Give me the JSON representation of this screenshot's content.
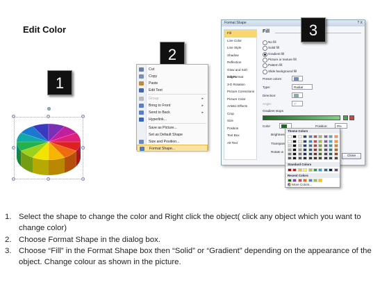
{
  "title": "Edit Color",
  "steps_badges": [
    "1",
    "2",
    "3"
  ],
  "context_menu": {
    "items": [
      {
        "label": "Cut",
        "icon": "scissors-icon",
        "icon_color": "#6a7f9c"
      },
      {
        "label": "Copy",
        "icon": "copy-icon",
        "icon_color": "#7d8fb0"
      },
      {
        "label": "Paste",
        "icon": "paste-icon",
        "icon_color": "#b88a45"
      },
      {
        "label": "Edit Text",
        "icon": "text-icon",
        "icon_color": "#4466aa"
      },
      {
        "label": "Group",
        "icon": "group-icon",
        "icon_color": "#bbbbbb",
        "disabled": true,
        "submenu": true
      },
      {
        "label": "Bring to Front",
        "icon": "bring-front-icon",
        "icon_color": "#5b7fc4",
        "submenu": true
      },
      {
        "label": "Send to Back",
        "icon": "send-back-icon",
        "icon_color": "#5b7fc4",
        "submenu": true
      },
      {
        "label": "Hyperlink...",
        "icon": "hyperlink-icon",
        "icon_color": "#3a66b8"
      },
      {
        "label": "Save as Picture...",
        "icon": "",
        "icon_color": ""
      },
      {
        "label": "Set as Default Shape",
        "icon": "",
        "icon_color": ""
      },
      {
        "label": "Size and Position...",
        "icon": "size-icon",
        "icon_color": "#6a8bc2"
      },
      {
        "label": "Format Shape...",
        "icon": "format-shape-icon",
        "icon_color": "#4a7cc9",
        "highlighted": true
      }
    ]
  },
  "format_dialog": {
    "title": "Format Shape",
    "close": "?  X",
    "sidebar": [
      "Fill",
      "Line Color",
      "Line Style",
      "Shadow",
      "Reflection",
      "Glow and Soft Edges",
      "3-D Format",
      "3-D Rotation",
      "Picture Corrections",
      "Picture Color",
      "Artistic Effects",
      "Crop",
      "Size",
      "Position",
      "Text Box",
      "Alt Text"
    ],
    "fill_heading": "Fill",
    "fill_options": [
      {
        "label": "No fill",
        "selected": false
      },
      {
        "label": "Solid fill",
        "selected": false
      },
      {
        "label": "Gradient fill",
        "selected": true
      },
      {
        "label": "Picture or texture fill",
        "selected": false
      },
      {
        "label": "Pattern fill",
        "selected": false
      },
      {
        "label": "Slide background fill",
        "selected": false
      }
    ],
    "preset_colors_label": "Preset colors:",
    "type_label": "Type:",
    "type_value": "Radial",
    "direction_label": "Direction:",
    "angle_label": "Angle:",
    "angle_value": "0°",
    "gradient_stops_label": "Gradient stops",
    "color_label": "Color",
    "position_label": "Position:",
    "position_value": "0%",
    "brightness_label": "Brightness:",
    "transparency_label": "Transparency:",
    "rotate_label": "Rotate w",
    "close_button": "Close"
  },
  "color_picker": {
    "theme_heading": "Theme Colors",
    "standard_heading": "Standard Colors",
    "recent_heading": "Recent Colors",
    "more_colors": "More Colors...",
    "theme_top": [
      "#ffffff",
      "#000000",
      "#eeece1",
      "#1f497d",
      "#4f81bd",
      "#c0504d",
      "#9bbb59",
      "#8064a2",
      "#4bacc6",
      "#f79646"
    ],
    "standard": [
      "#c00000",
      "#ff0000",
      "#ffc000",
      "#ffff00",
      "#92d050",
      "#00b050",
      "#00b0f0",
      "#0070c0",
      "#002060",
      "#7030a0"
    ],
    "recent": [
      "#1e6b1e",
      "#7f3f98",
      "#c0504d",
      "#e46c0a",
      "#4f81bd",
      "#9bbb59",
      "#ffc000"
    ]
  },
  "instructions": [
    {
      "num": "1.",
      "text": "Select the shape to change the color and Right click the object( click any object which you want to change color)"
    },
    {
      "num": "2.",
      "text": "Choose Format Shape in the dialog box."
    },
    {
      "num": "3.",
      "text": "Choose “Fill” in the Format Shape box then “Solid” or “Gradient” depending on the appearance of the object. Change colour as shown in the picture."
    }
  ],
  "pie_colors": [
    "#e02020",
    "#f06a10",
    "#f7b500",
    "#f2e300",
    "#9bd11b",
    "#22b14c",
    "#10a8a8",
    "#1a78d2",
    "#3a3ac0",
    "#7a2fb5",
    "#c21f9e",
    "#e0207a"
  ]
}
